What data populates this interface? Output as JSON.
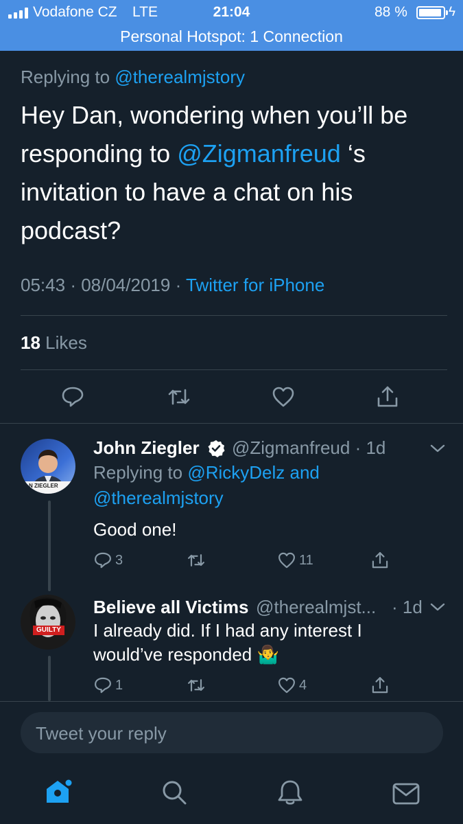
{
  "status_bar": {
    "carrier": "Vodafone CZ",
    "network": "LTE",
    "time": "21:04",
    "battery_percent": "88 %",
    "battery_level": 0.88,
    "hotspot": "Personal Hotspot: 1 Connection",
    "bar_color": "#4a8fe3"
  },
  "main_tweet": {
    "replying_prefix": "Replying to",
    "replying_to": "@therealmjstory",
    "text_part1": "Hey Dan, wondering when you’ll be responding to",
    "text_mention": "@Zigmanfreud",
    "text_part2": "‘s invitation to have a chat on his podcast?",
    "time": "05:43",
    "date": "08/04/2019",
    "source": "Twitter for iPhone",
    "likes_count": "18",
    "likes_label": "Likes",
    "actions": [
      "reply-icon",
      "retweet-icon",
      "like-icon",
      "share-icon"
    ]
  },
  "replies": [
    {
      "name": "John Ziegler",
      "verified": true,
      "handle": "@Zigmanfreud",
      "age": "· 1d",
      "replying_prefix": "Replying to",
      "replying_to_1": "@RickyDelz",
      "replying_and": "and",
      "replying_to_2": "@therealmjstory",
      "text": "Good one!",
      "reply_count": "3",
      "retweet_count": "",
      "like_count": "11",
      "avatar_caption": "N ZIEGLER"
    },
    {
      "name": "Believe all Victims",
      "verified": false,
      "handle": "@therealmjst...",
      "age": "· 1d",
      "text_line1": "I already did. If I had any interest I",
      "text_line2": "would’ve responded 🤷‍♂️",
      "reply_count": "1",
      "retweet_count": "",
      "like_count": "4",
      "avatar_caption": "GUILTY"
    }
  ],
  "reply_box": {
    "placeholder": "Tweet your reply"
  },
  "tab_bar": {
    "tabs": [
      "home-icon",
      "search-icon",
      "notifications-icon",
      "messages-icon"
    ],
    "active": "home-icon"
  },
  "colors": {
    "background": "#15202b",
    "accent": "#1da1f2",
    "muted": "#8899a6",
    "divider": "#38444d"
  }
}
